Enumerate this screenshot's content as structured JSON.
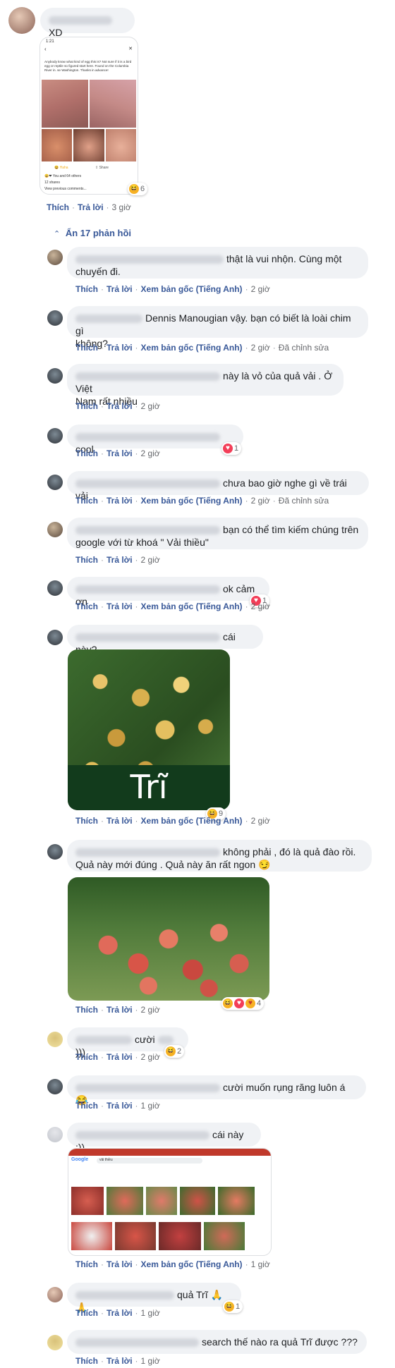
{
  "top_comment": {
    "text": "XD",
    "reaction_count": "6",
    "like": "Thích",
    "reply": "Trả lời",
    "time": "3 giờ",
    "screenshot": {
      "status_time": "1:21",
      "post_text": "Anybody know what kind of egg this is? Not sure if it is a bird egg or reptile so figured start here. Found on the Columbia River in. se Washington. Thanks in advance!",
      "react_label": "Haha",
      "share_label": "Share",
      "likes_text": "You and 64 others",
      "shares_text": "12 shares",
      "prev_comments": "View previous comments..."
    }
  },
  "hide_replies": "Ẩn 17 phản hồi",
  "actions": {
    "like": "Thích",
    "reply": "Trả lời",
    "see_original": "Xem bản gốc (Tiếng Anh)",
    "edited": "Đã chỉnh sửa"
  },
  "replies": [
    {
      "line1": "thật là vui nhộn. Cùng một",
      "line2": "chuyến đi.",
      "time": "2 giờ"
    },
    {
      "line1": "Dennis Manougian vậy. bạn có biết là loài chim gì",
      "line2": "không?",
      "time": "2 giờ"
    },
    {
      "line1": "này là vỏ của quả vải . Ở Việt",
      "line2": "Nam rất nhiều",
      "time": "2 giờ"
    },
    {
      "line1": "cool",
      "time": "2 giờ",
      "reaction_count": "1"
    },
    {
      "line1": "chưa bao giờ nghe gì về trái vải",
      "time": "2 giờ"
    },
    {
      "line1": "bạn có thể tìm kiếm chúng trên",
      "line2": "google với từ khoá \" Vải thiều\"",
      "time": "2 giờ"
    },
    {
      "line1": "ok cảm ơn",
      "time": "2 giờ",
      "reaction_count": "1"
    },
    {
      "line1": "cái này?",
      "time": "2 giờ",
      "reaction_count": "9",
      "image_caption": "Trĩ"
    },
    {
      "line1": "không phải , đó là quả đào rồi.",
      "line2": "Quả này mới đúng . Quả này ăn rất ngon 😏",
      "time": "2 giờ",
      "reaction_count": "4"
    },
    {
      "line1": "cười",
      "line1b": ")))",
      "time": "2 giờ",
      "reaction_count": "2"
    },
    {
      "line1": "cười muốn rụng răng luôn á 😂",
      "time": "1 giờ"
    },
    {
      "line1": "cái này :))",
      "time": "1 giờ",
      "search_logo": "Google",
      "search_query": "vải thiều"
    },
    {
      "line1": "quả Trĩ 🙏🙏",
      "time": "1 giờ",
      "reaction_count": "1"
    },
    {
      "line1": "search thế nào ra quả Trĩ được ???",
      "time": "1 giờ"
    }
  ],
  "colors": {
    "link": "#385898",
    "bubble": "#f0f2f5",
    "meta": "#65676b"
  }
}
